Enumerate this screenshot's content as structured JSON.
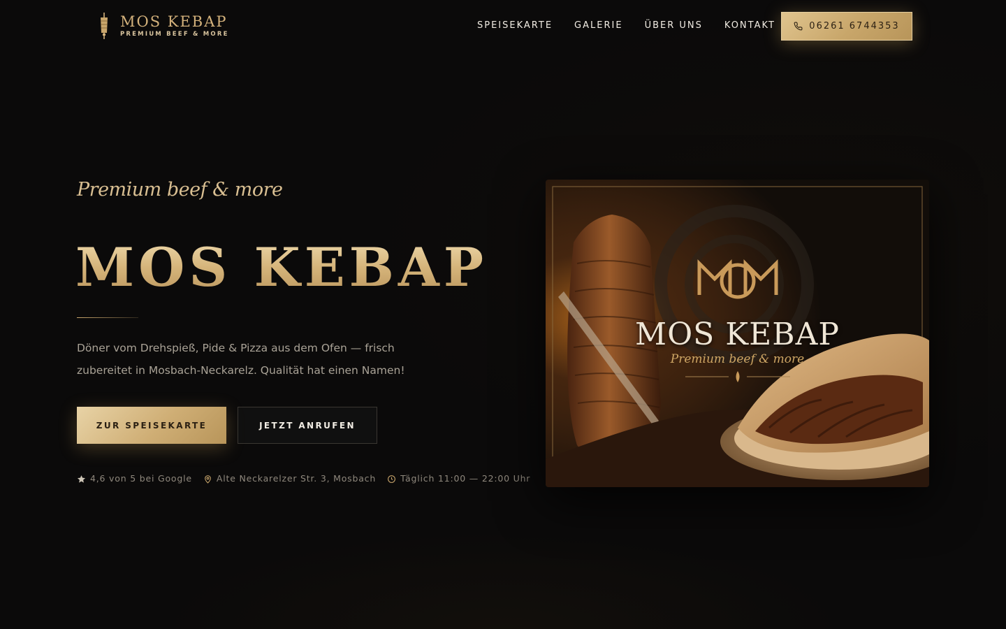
{
  "brand": {
    "name": "MOS KEBAP",
    "subtitle": "PREMIUM BEEF & MORE"
  },
  "nav": {
    "items": [
      "SPEISEKARTE",
      "GALERIE",
      "ÜBER UNS",
      "KONTAKT"
    ],
    "phone": "06261 6744353"
  },
  "hero": {
    "tagline": "Premium beef & more",
    "title": "MOS KEBAP",
    "description": "Döner vom Drehspieß, Pide & Pizza aus dem Ofen — frisch zubereitet in Mosbach-Neckarelz. Qualität hat einen Namen!",
    "primary_cta": "ZUR SPEISEKARTE",
    "secondary_cta": "JETZT ANRUFEN",
    "meta": {
      "rating": "4,6 von 5 bei Google",
      "address": "Alte Neckarelzer Str. 3, Mosbach",
      "hours": "Täglich 11:00 — 22:00 Uhr"
    },
    "image": {
      "title": "MOS KEBAP",
      "subtitle": "Premium beef & more"
    }
  },
  "colors": {
    "background": "#0b0a0a",
    "gold": "#d4b27c",
    "gold_button": "#cfae75",
    "text_muted": "#a9a296"
  },
  "icons": {
    "logo": "doner-skewer-icon",
    "phone": "phone-icon",
    "rating": "star-icon",
    "address": "map-pin-icon",
    "hours": "clock-icon"
  }
}
